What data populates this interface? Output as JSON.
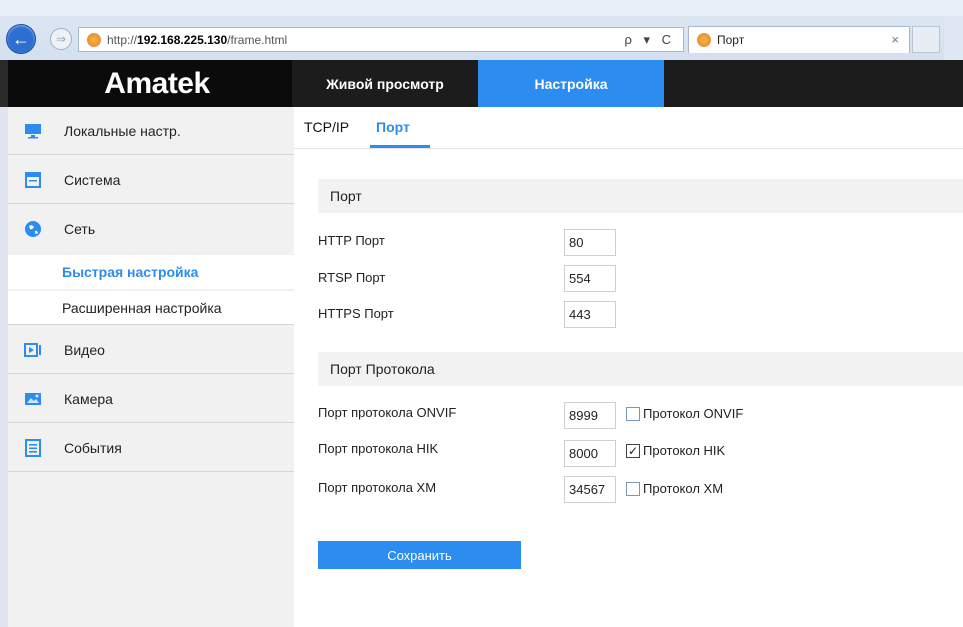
{
  "browser": {
    "url_prefix": "http://",
    "url_host": "192.168.225.130",
    "url_path": "/frame.html",
    "address_tools": "ρ ▾ C",
    "tab_title": "Порт",
    "tab_close": "×",
    "back_glyph": "←",
    "forward_glyph": "⇒"
  },
  "header": {
    "logo": "Amatek",
    "nav": [
      {
        "label": "Живой просмотр",
        "active": false
      },
      {
        "label": "Настройка",
        "active": true
      }
    ],
    "accent_color": "#2d8cf0"
  },
  "sidebar": {
    "items": [
      {
        "label": "Локальные настр.",
        "icon": "monitor-icon"
      },
      {
        "label": "Система",
        "icon": "system-icon"
      },
      {
        "label": "Сеть",
        "icon": "globe-icon"
      },
      {
        "label": "Видео",
        "icon": "video-icon"
      },
      {
        "label": "Камера",
        "icon": "image-icon"
      },
      {
        "label": "События",
        "icon": "events-icon"
      }
    ],
    "network_subitems": [
      {
        "label": "Быстрая настройка",
        "active": true
      },
      {
        "label": "Расширенная настройка",
        "active": false
      }
    ]
  },
  "content": {
    "tabs": [
      {
        "label": "TCP/IP",
        "active": false
      },
      {
        "label": "Порт",
        "active": true
      }
    ],
    "port_section": {
      "title": "Порт",
      "fields": [
        {
          "label": "HTTP Порт",
          "value": "80"
        },
        {
          "label": "RTSP Порт",
          "value": "554"
        },
        {
          "label": "HTTPS Порт",
          "value": "443"
        }
      ]
    },
    "protocol_section": {
      "title": "Порт Протокола",
      "fields": [
        {
          "label": "Порт протокола ONVIF",
          "value": "8999",
          "checkbox_label": "Протокол ONVIF",
          "checked": false
        },
        {
          "label": "Порт протокола HIK",
          "value": "8000",
          "checkbox_label": "Протокол HIK",
          "checked": true
        },
        {
          "label": "Порт протокола XM",
          "value": "34567",
          "checkbox_label": "Протокол XM",
          "checked": false
        }
      ]
    },
    "save_label": "Сохранить",
    "check_mark": "✓"
  }
}
